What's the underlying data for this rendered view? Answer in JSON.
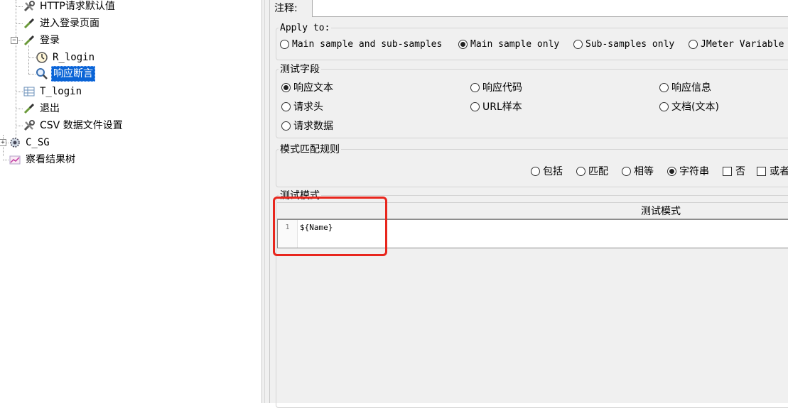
{
  "tree": {
    "items": [
      {
        "label": "HTTP请求默认值",
        "icon": "wrench-icon"
      },
      {
        "label": "进入登录页面",
        "icon": "pipette-icon"
      },
      {
        "label": "登录",
        "icon": "pipette-icon"
      },
      {
        "label": "R_login",
        "icon": "timer-icon"
      },
      {
        "label": "响应断言",
        "icon": "magnifier-icon"
      },
      {
        "label": "T_login",
        "icon": "table-icon"
      },
      {
        "label": "退出",
        "icon": "pipette-icon"
      },
      {
        "label": "CSV 数据文件设置",
        "icon": "wrench-icon"
      },
      {
        "label": "C_SG",
        "icon": "gear-icon"
      },
      {
        "label": "察看结果树",
        "icon": "graph-icon"
      }
    ],
    "expander_minus": "−",
    "expander_plus": "+"
  },
  "comment": {
    "label": "注释:",
    "value": ""
  },
  "apply_to": {
    "title": "Apply to:",
    "options": [
      "Main sample and sub-samples",
      "Main sample only",
      "Sub-samples only",
      "JMeter Variable"
    ],
    "selected": "Main sample only"
  },
  "test_field": {
    "title": "测试字段",
    "options": [
      "响应文本",
      "响应代码",
      "响应信息",
      "请求头",
      "URL样本",
      "文档(文本)",
      "请求数据"
    ],
    "selected": "响应文本"
  },
  "pattern_rules": {
    "title": "模式匹配规则",
    "radios": [
      "包括",
      "匹配",
      "相等",
      "字符串"
    ],
    "selected": "字符串",
    "checks": [
      "否",
      "或者"
    ]
  },
  "test_patterns": {
    "title": "测试模式",
    "column_header": "测试模式",
    "line_number": "1",
    "pattern": "${Name}"
  },
  "colors": {
    "selection": "#0a64d6",
    "highlight_box": "#e8261d"
  }
}
